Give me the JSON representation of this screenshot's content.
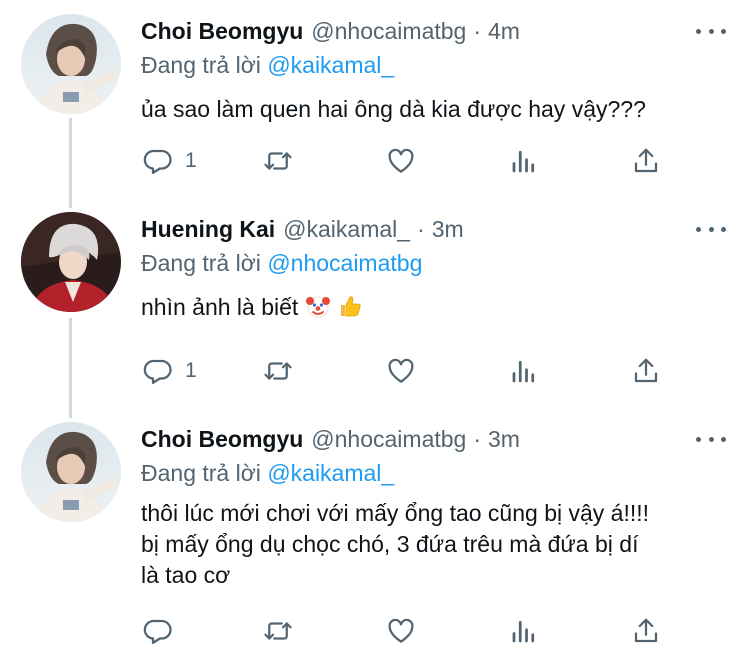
{
  "tweets": [
    {
      "name": "Choi Beomgyu",
      "handle": "@nhocaimatbg",
      "dot": "·",
      "time": "4m",
      "reply_prefix": "Đang trả lời",
      "reply_mention": "@kaikamal_",
      "text": "ủa sao làm quen hai ông dà kia được hay vậy???",
      "reply_count": "1",
      "avatar": "avatar-beomgyu"
    },
    {
      "name": "Huening Kai",
      "handle": "@kaikamal_",
      "dot": "·",
      "time": "3m",
      "reply_prefix": "Đang trả lời",
      "reply_mention": "@nhocaimatbg",
      "text": "nhìn ảnh là biết",
      "emojis": [
        "clown-face-emoji",
        "thumbs-up-emoji"
      ],
      "reply_count": "1",
      "avatar": "avatar-kai"
    },
    {
      "name": "Choi Beomgyu",
      "handle": "@nhocaimatbg",
      "dot": "·",
      "time": "3m",
      "reply_prefix": "Đang trả lời",
      "reply_mention": "@kaikamal_",
      "text_lines": [
        "thôi lúc mới chơi với mấy ổng tao cũng bị vậy á!!!!",
        "bị mấy ổng dụ chọc chó, 3 đứa trêu mà đứa bị dí",
        "là tao cơ"
      ],
      "reply_count": "",
      "avatar": "avatar-beomgyu"
    }
  ],
  "icons": {
    "reply": "reply-icon",
    "retweet": "retweet-icon",
    "like": "heart-icon",
    "analytics": "analytics-icon",
    "share": "share-icon",
    "more": "more-icon"
  },
  "colors": {
    "text": "#0f1419",
    "secondary": "#536471",
    "mention": "#1d9bf0",
    "thread_line": "#cfd9de"
  }
}
